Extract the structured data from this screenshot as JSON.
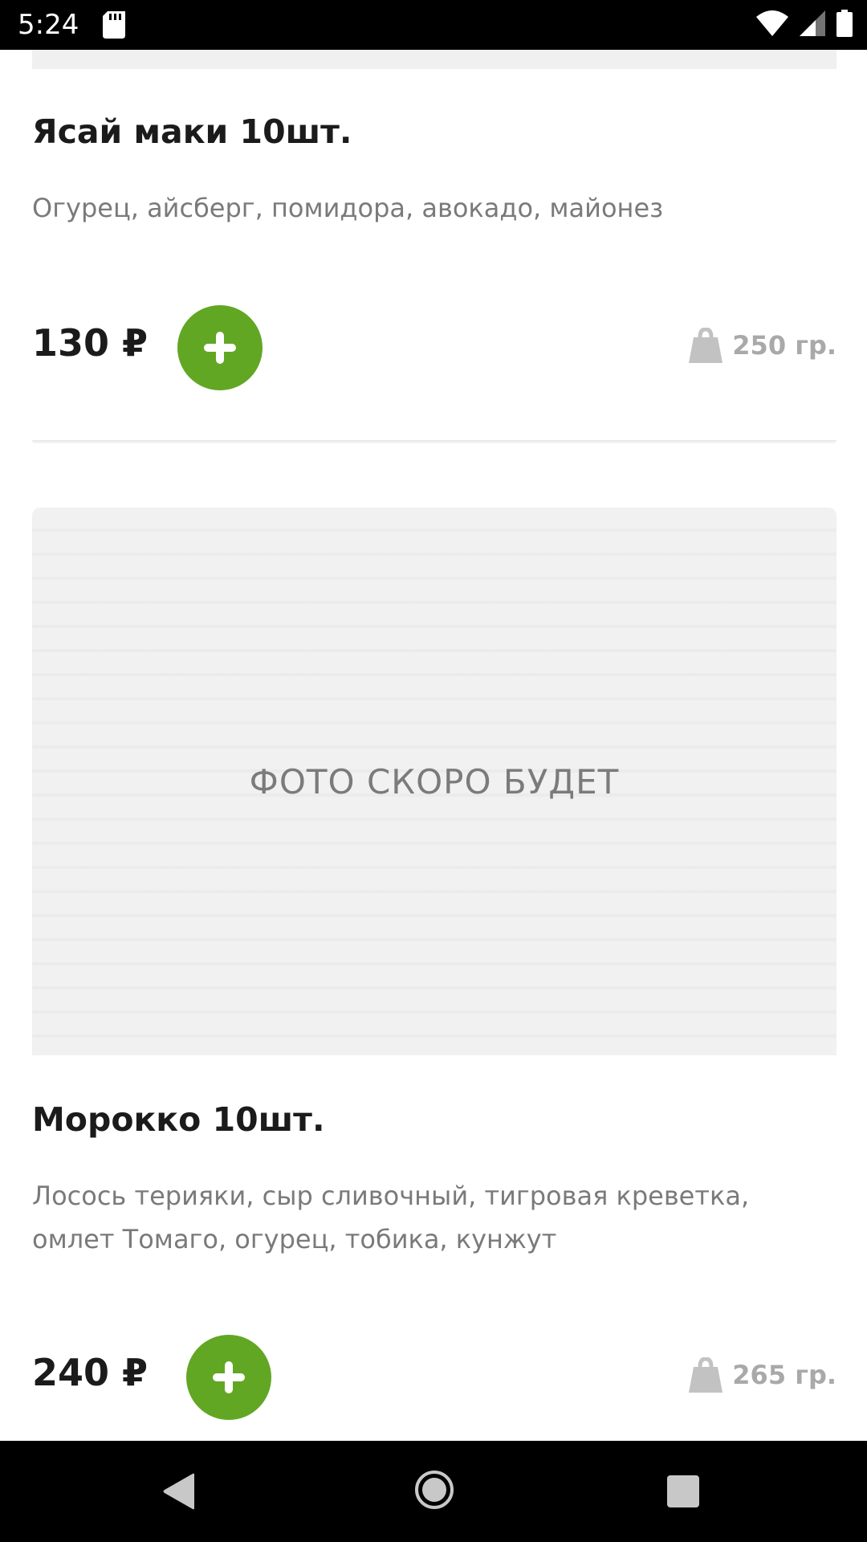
{
  "status_bar": {
    "time": "5:24",
    "icons": [
      "sd-card-icon",
      "wifi-icon",
      "signal-icon",
      "battery-icon"
    ]
  },
  "products": [
    {
      "title": "Ясай маки 10шт.",
      "description": "Огурец, айсберг, помидора, авокадо, майонез",
      "price": "130 ₽",
      "weight": "250 гр."
    },
    {
      "photo_placeholder": "ФОТО СКОРО БУДЕТ",
      "title": "Морокко 10шт.",
      "description": "Лосось терияки, сыр сливочный, тигровая креветка, омлет Томаго, огурец, тобика, кунжут",
      "price": "240 ₽",
      "weight": "265 гр."
    }
  ],
  "colors": {
    "accent_green": "#62a723",
    "muted_gray": "#a9a9a9",
    "text_dark": "#1b1b1b",
    "placeholder_bg": "#f1f1f1"
  },
  "nav_bar": {
    "icons": [
      "back-icon",
      "home-icon",
      "recents-icon"
    ]
  }
}
